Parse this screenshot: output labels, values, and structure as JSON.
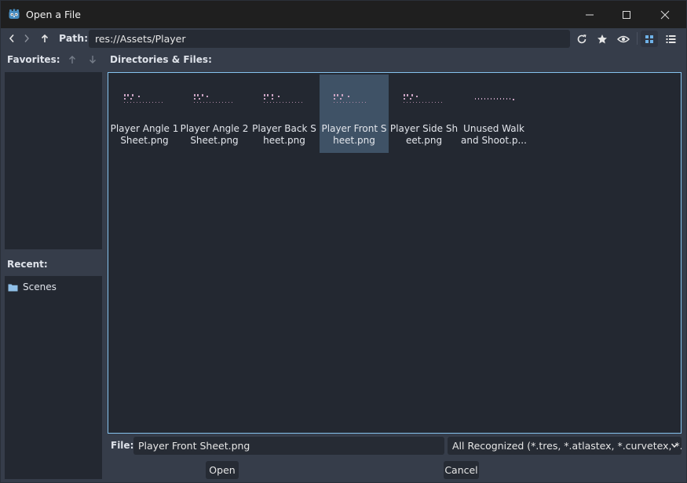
{
  "window": {
    "title": "Open a File"
  },
  "toolbar": {
    "path_label": "Path:",
    "path_value": "res://Assets/Player"
  },
  "favorites": {
    "label": "Favorites:"
  },
  "recent": {
    "label": "Recent:",
    "items": [
      "Scenes"
    ]
  },
  "files": {
    "label": "Directories & Files:",
    "items": [
      {
        "name": "Player Angle 1 Sheet.png",
        "selected": false
      },
      {
        "name": "Player Angle 2 Sheet.png",
        "selected": false
      },
      {
        "name": "Player Back Sheet.png",
        "selected": false
      },
      {
        "name": "Player Front Sheet.png",
        "selected": true
      },
      {
        "name": "Player Side Sheet.png",
        "selected": false
      },
      {
        "name": "Unused Walk and Shoot.p...",
        "selected": false
      }
    ]
  },
  "bottom": {
    "file_label": "File:",
    "file_value": "Player Front Sheet.png",
    "filter_value": "All Recognized (*.tres, *.atlastex, *.curvetex, *.mesh",
    "open_label": "Open",
    "cancel_label": "Cancel"
  },
  "colors": {
    "accent": "#86c3ef",
    "selection": "#3f5266",
    "panel": "#232831",
    "background": "#363d4a"
  }
}
